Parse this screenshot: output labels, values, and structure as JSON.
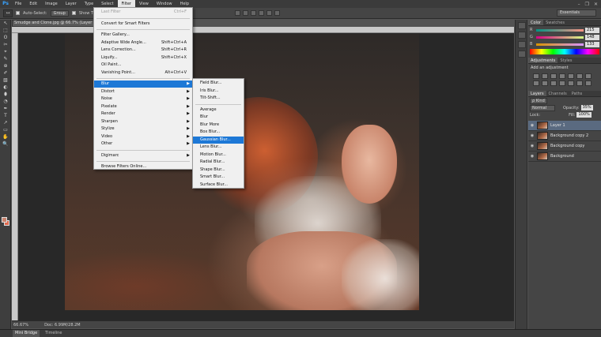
{
  "app": {
    "logo": "Ps"
  },
  "menu": {
    "items": [
      "File",
      "Edit",
      "Image",
      "Layer",
      "Type",
      "Select",
      "Filter",
      "View",
      "Window",
      "Help"
    ],
    "active": "Filter"
  },
  "window_controls": [
    "–",
    "❐",
    "✕"
  ],
  "options_bar": {
    "auto_select_label": "Auto-Select:",
    "auto_select_value": "Group",
    "show_label": "Show T",
    "workspace": "Essentials"
  },
  "document": {
    "tab_title": "Smudge and Clone.jpg @ 66.7% (Layer 1, RG",
    "zoom": "66.67%",
    "doc_info": "Doc: 6.99M/28.2M"
  },
  "bottom_tabs": [
    "Mini Bridge",
    "Timeline"
  ],
  "filter_menu": [
    {
      "label": "Last Filter",
      "shortcut": "Ctrl+F",
      "disabled": true
    },
    {
      "sep": true
    },
    {
      "label": "Convert for Smart Filters"
    },
    {
      "sep": true
    },
    {
      "label": "Filter Gallery..."
    },
    {
      "label": "Adaptive Wide Angle...",
      "shortcut": "Shift+Ctrl+A"
    },
    {
      "label": "Lens Correction...",
      "shortcut": "Shift+Ctrl+R"
    },
    {
      "label": "Liquify...",
      "shortcut": "Shift+Ctrl+X"
    },
    {
      "label": "Oil Paint..."
    },
    {
      "label": "Vanishing Point...",
      "shortcut": "Alt+Ctrl+V"
    },
    {
      "sep": true
    },
    {
      "label": "Blur",
      "submenu": true,
      "highlighted": true
    },
    {
      "label": "Distort",
      "submenu": true
    },
    {
      "label": "Noise",
      "submenu": true
    },
    {
      "label": "Pixelate",
      "submenu": true
    },
    {
      "label": "Render",
      "submenu": true
    },
    {
      "label": "Sharpen",
      "submenu": true
    },
    {
      "label": "Stylize",
      "submenu": true
    },
    {
      "label": "Video",
      "submenu": true
    },
    {
      "label": "Other",
      "submenu": true
    },
    {
      "sep": true
    },
    {
      "label": "Digimarc",
      "submenu": true
    },
    {
      "sep": true
    },
    {
      "label": "Browse Filters Online..."
    }
  ],
  "blur_menu": [
    {
      "label": "Field Blur..."
    },
    {
      "label": "Iris Blur..."
    },
    {
      "label": "Tilt-Shift..."
    },
    {
      "sep": true
    },
    {
      "label": "Average"
    },
    {
      "label": "Blur"
    },
    {
      "label": "Blur More"
    },
    {
      "label": "Box Blur..."
    },
    {
      "label": "Gaussian Blur...",
      "highlighted": true
    },
    {
      "label": "Lens Blur..."
    },
    {
      "label": "Motion Blur..."
    },
    {
      "label": "Radial Blur..."
    },
    {
      "label": "Shape Blur..."
    },
    {
      "label": "Smart Blur..."
    },
    {
      "label": "Surface Blur..."
    }
  ],
  "color_panel": {
    "tabs": [
      "Color",
      "Swatches"
    ],
    "rows": [
      {
        "label": "R",
        "value": "215",
        "gradient": "linear-gradient(90deg,#009484,#ff9484)"
      },
      {
        "label": "G",
        "value": "148",
        "gradient": "linear-gradient(90deg,#d70084,#d7ff84)"
      },
      {
        "label": "B",
        "value": "133",
        "gradient": "linear-gradient(90deg,#d79400,#d794ff)"
      }
    ]
  },
  "adjustments_panel": {
    "tabs": [
      "Adjustments",
      "Styles"
    ],
    "title": "Add an adjustment"
  },
  "layers_panel": {
    "tabs": [
      "Layers",
      "Channels",
      "Paths"
    ],
    "kind": "ρ Kind",
    "blend_mode": "Normal",
    "opacity_label": "Opacity:",
    "opacity": "35%",
    "lock_label": "Lock:",
    "fill_label": "Fill:",
    "fill": "100%",
    "layers": [
      {
        "name": "Layer 1",
        "selected": true
      },
      {
        "name": "Background copy 2"
      },
      {
        "name": "Background copy"
      },
      {
        "name": "Background"
      }
    ]
  },
  "tools": [
    "↖",
    "⬚",
    "ʘ",
    "✂",
    "⌖",
    "✎",
    "⊕",
    "✐",
    "▧",
    "◐",
    "⬮",
    "◔",
    "✒",
    "T",
    "↗",
    "▭",
    "✋",
    "🔍"
  ]
}
